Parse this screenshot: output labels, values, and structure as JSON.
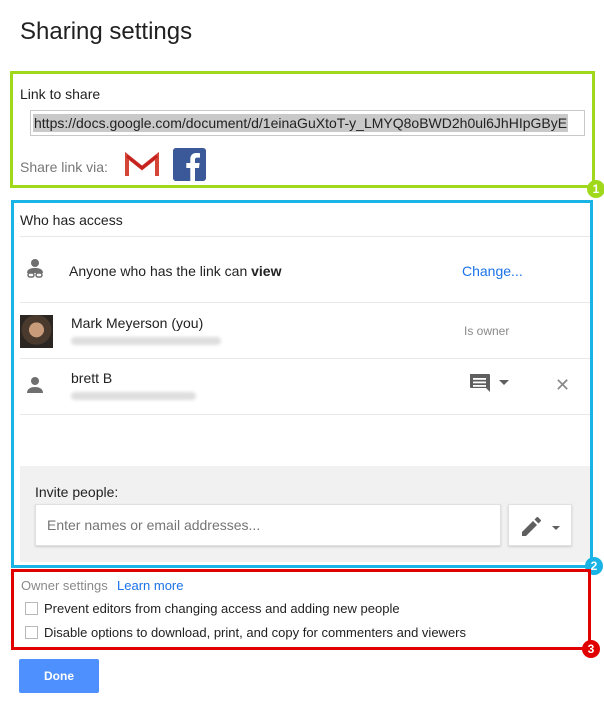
{
  "dialog": {
    "title": "Sharing settings"
  },
  "link_section": {
    "label": "Link to share",
    "url": "https://docs.google.com/document/d/1einaGuXtoT-y_LMYQ8oBWD2h0ul6JhHIpGByE",
    "share_via_label": "Share link via:",
    "badge": "1",
    "icons": [
      "gmail-icon",
      "facebook-icon"
    ]
  },
  "access_section": {
    "heading": "Who has access",
    "badge": "2",
    "link_row": {
      "text_prefix": "Anyone who has the link can ",
      "permission": "view",
      "change_label": "Change..."
    },
    "people": [
      {
        "name": "Mark Meyerson (you)",
        "role": "Is owner"
      },
      {
        "name": "brett B"
      }
    ],
    "invite": {
      "label": "Invite people:",
      "placeholder": "Enter names or email addresses..."
    }
  },
  "owner_section": {
    "label": "Owner settings",
    "learn_more": "Learn more",
    "badge": "3",
    "options": [
      {
        "label": "Prevent editors from changing access and adding new people",
        "checked": false
      },
      {
        "label": "Disable options to download, print, and copy for commenters and viewers",
        "checked": false
      }
    ]
  },
  "footer": {
    "done_label": "Done"
  },
  "colors": {
    "green": "#a0d91b",
    "blue": "#19b3e6",
    "red": "#e00000",
    "primary": "#4d90fe",
    "link": "#1a73e8"
  }
}
